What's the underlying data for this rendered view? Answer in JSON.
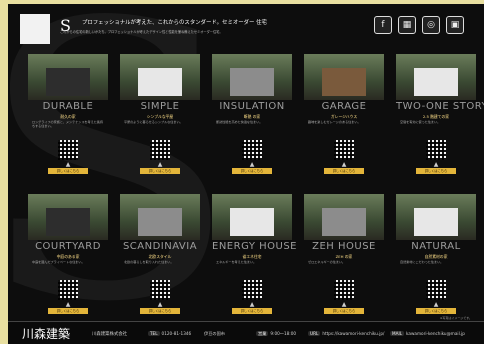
{
  "header": {
    "logo_letter": "S",
    "tagline": "プロフェッショナルが考えた、これからのスタンダード。セミオーダー 住宅",
    "intro": "これからの住宅の新しいかたち。プロフェッショナルが考えたデザイン性と性能を兼ね備えたセミオーダー住宅。"
  },
  "social": [
    "f",
    "▦",
    "◎",
    "▣"
  ],
  "rows": [
    [
      {
        "title": "DURABLE",
        "subtitle": "耐久の家",
        "desc": "ロングライフの家族と、メンテナンスを考えた長持ちする住まい。",
        "badge": "詳しくはこちら",
        "house": "dark"
      },
      {
        "title": "SIMPLE",
        "subtitle": "シンプルな平屋",
        "desc": "平屋のように暮らせるシンプルな住まい。",
        "badge": "詳しくはこちら",
        "house": "white"
      },
      {
        "title": "INSULATION",
        "subtitle": "断熱 の家",
        "desc": "断熱性能を高めた快適な住まい。",
        "badge": "詳しくはこちら",
        "house": "grey"
      },
      {
        "title": "GARAGE",
        "subtitle": "ガレージハウス",
        "desc": "趣味を楽しむガレージのある住まい。",
        "badge": "詳しくはこちら",
        "house": "wood"
      },
      {
        "title": "TWO-ONE STORY",
        "subtitle": "2.5 階建ての家",
        "desc": "空間を有効に使った住まい。",
        "badge": "詳しくはこちら",
        "house": "white"
      }
    ],
    [
      {
        "title": "COURTYARD",
        "subtitle": "中庭のある家",
        "desc": "中庭を囲んだプライベートな住まい。",
        "badge": "詳しくはこちら",
        "house": "dark"
      },
      {
        "title": "SCANDINAVIA",
        "subtitle": "北欧スタイル",
        "desc": "北欧の暮らしを取り入れた住まい。",
        "badge": "詳しくはこちら",
        "house": "grey"
      },
      {
        "title": "ENERGY HOUSE",
        "subtitle": "省エネ住宅",
        "desc": "エネルギーを考えた住まい。",
        "badge": "詳しくはこちら",
        "house": "white"
      },
      {
        "title": "ZEH HOUSE",
        "subtitle": "ZEH の家",
        "desc": "ゼロエネルギーの住まい。",
        "badge": "詳しくはこちら",
        "house": "grey"
      },
      {
        "title": "NATURAL",
        "subtitle": "自然素材の家",
        "desc": "自然素材にこだわった住まい。",
        "badge": "詳しくはこちら",
        "house": "white"
      }
    ]
  ],
  "note": "※写真はイメージです。",
  "footer": {
    "company": "川森建築",
    "company_official": "川森建築株式会社",
    "phone_label": "TEL",
    "phone": "0120-81-1346",
    "item2": "伊豆の国市",
    "hours_label": "営業",
    "hours": "9:00～18:00",
    "url_label": "URL",
    "url": "https://kawamori-kenchiku.jp/",
    "email_label": "MAIL",
    "email": "kawamori-kenchiku@mail.jp"
  }
}
